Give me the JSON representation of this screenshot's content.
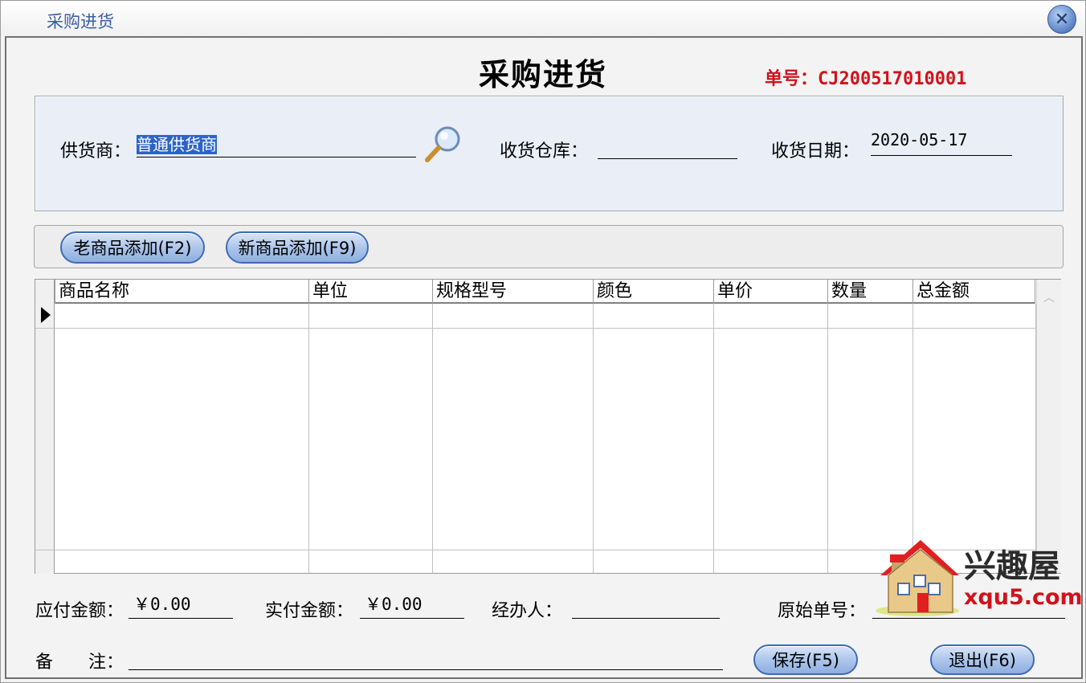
{
  "window": {
    "title": "采购进货"
  },
  "form": {
    "heading": "采购进货",
    "order_no": "单号：CJ200517010001"
  },
  "info": {
    "supplier_label": "供货商：",
    "supplier_value": "普通供货商",
    "warehouse_label": "收货仓库：",
    "warehouse_value": "",
    "date_label": "收货日期：",
    "date_value": "2020-05-17"
  },
  "actions": {
    "add_old": "老商品添加(F2)",
    "add_new": "新商品添加(F9)"
  },
  "grid": {
    "columns": [
      "商品名称",
      "单位",
      "规格型号",
      "颜色",
      "单价",
      "数量",
      "总金额"
    ]
  },
  "footer": {
    "payable_label": "应付金额：",
    "payable_value": "￥0.00",
    "paid_label": "实付金额：",
    "paid_value": "￥0.00",
    "handler_label": "经办人：",
    "handler_value": "",
    "orig_no_label": "原始单号：",
    "orig_no_value": "",
    "remark_label": "备　　注：",
    "remark_value": "",
    "save": "保存(F5)",
    "exit": "退出(F6)"
  },
  "watermark": {
    "cn": "兴趣屋",
    "en": "xqu5.com"
  }
}
